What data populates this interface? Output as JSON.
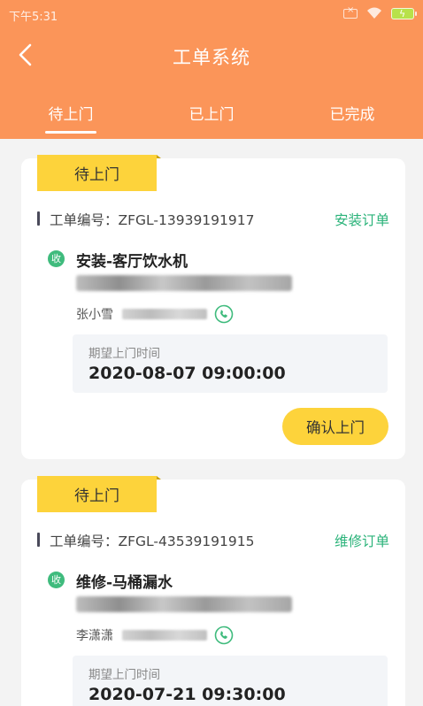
{
  "status_bar": {
    "time": "下午5:31"
  },
  "header": {
    "title": "工单系统",
    "tabs": [
      {
        "label": "待上门",
        "active": true
      },
      {
        "label": "已上门",
        "active": false
      },
      {
        "label": "已完成",
        "active": false
      }
    ]
  },
  "colors": {
    "header": "#fb9559",
    "badge": "#fdd33b",
    "order_type": "#2bb37a",
    "recv_icon": "#3fbb7d"
  },
  "orders": [
    {
      "status": "待上门",
      "order_no": "工单编号：ZFGL-13939191917",
      "order_type": "安装订单",
      "recv_icon": "收",
      "service": "安装-客厅饮水机",
      "contact_name": "张小雪",
      "time_label": "期望上门时间",
      "time_value": "2020-08-07 09:00:00",
      "action": "确认上门"
    },
    {
      "status": "待上门",
      "order_no": "工单编号：ZFGL-43539191915",
      "order_type": "维修订单",
      "recv_icon": "收",
      "service": "维修-马桶漏水",
      "contact_name": "李潇潇",
      "time_label": "期望上门时间",
      "time_value": "2020-07-21 09:30:00"
    }
  ]
}
